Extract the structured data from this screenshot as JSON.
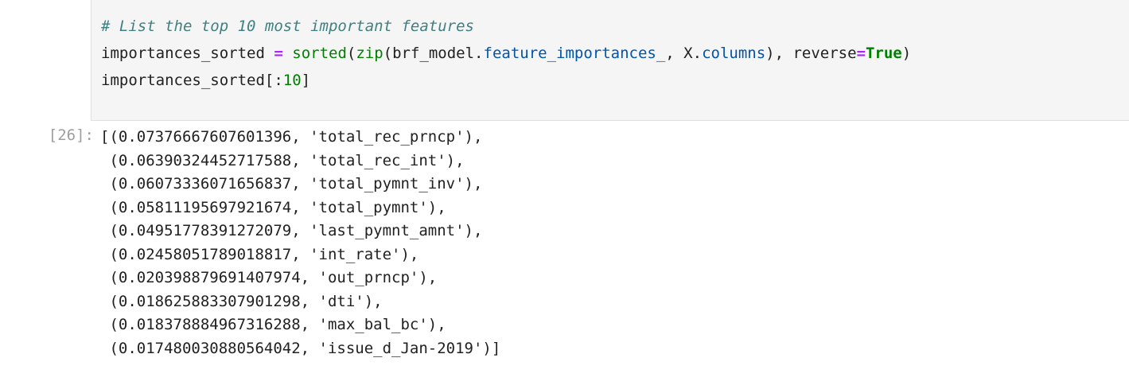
{
  "cell": {
    "code": {
      "comment": "# List the top 10 most important features",
      "line2": {
        "var": "importances_sorted ",
        "assign": "=",
        "space": " ",
        "sorted_fn": "sorted",
        "open1": "(",
        "zip_fn": "zip",
        "open2": "(brf_model.",
        "attr1": "feature_importances_",
        "sep": ", X.",
        "attr2": "columns",
        "mid": "), reverse",
        "eq": "=",
        "true_kw": "True",
        "close": ")"
      },
      "line3": {
        "var": "importances_sorted[:",
        "num": "10",
        "close": "]"
      }
    },
    "execution_count_prompt": "[26]:",
    "output_lines": [
      "[(0.07376667607601396, 'total_rec_prncp'),",
      " (0.06390324452717588, 'total_rec_int'),",
      " (0.06073336071656837, 'total_pymnt_inv'),",
      " (0.05811195697921674, 'total_pymnt'),",
      " (0.04951778391272079, 'last_pymnt_amnt'),",
      " (0.02458051789018817, 'int_rate'),",
      " (0.020398879691407974, 'out_prncp'),",
      " (0.018625883307901298, 'dti'),",
      " (0.018378884967316288, 'max_bal_bc'),",
      " (0.017480030880564042, 'issue_d_Jan-2019')]"
    ]
  }
}
